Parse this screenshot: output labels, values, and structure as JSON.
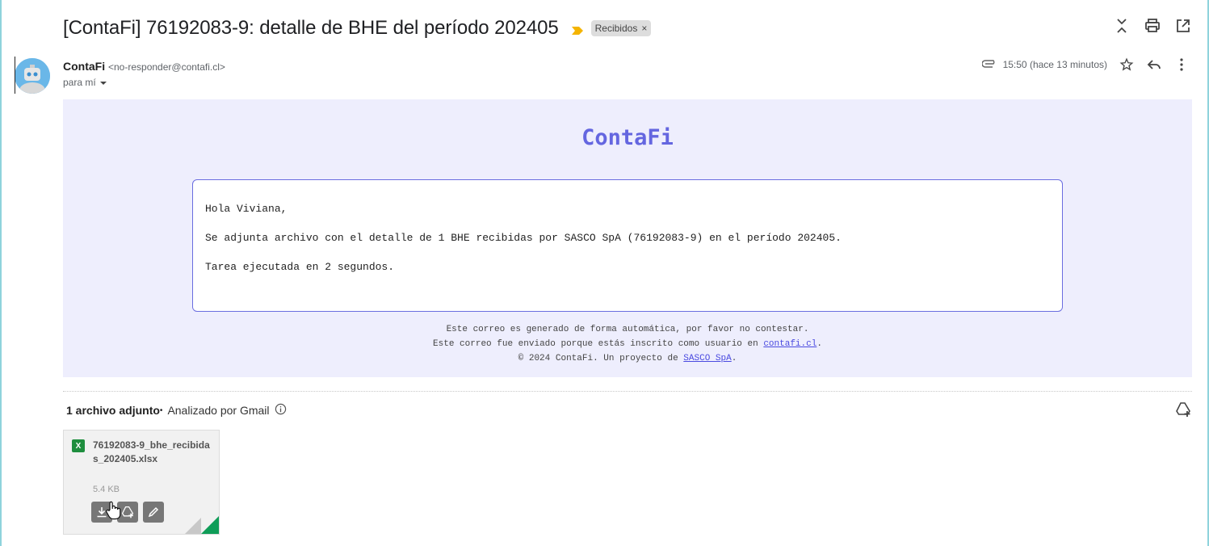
{
  "subject": "[ContaFi] 76192083-9: detalle de BHE del período 202405",
  "label": {
    "name": "Recibidos",
    "remove": "×"
  },
  "sender": {
    "name": "ContaFi",
    "email": "<no-responder@contafi.cl>",
    "to": "para mí"
  },
  "time": "15:50 (hace 13 minutos)",
  "body": {
    "brand": "ContaFi",
    "greeting": "Hola Viviana,",
    "line1": "Se adjunta archivo con el detalle de 1 BHE recibidas por SASCO SpA (76192083-9) en el período 202405.",
    "line2": "Tarea ejecutada en 2 segundos.",
    "footer1": "Este correo es generado de forma automática, por favor no contestar.",
    "footer2_pre": "Este correo fue enviado porque estás inscrito como usuario en ",
    "footer2_link": "contafi.cl",
    "footer2_post": ".",
    "footer3_pre": "© 2024 ContaFi. Un proyecto de ",
    "footer3_link": "SASCO SpA",
    "footer3_post": "."
  },
  "attachments": {
    "count_label": "1 archivo adjunto",
    "separator": "•",
    "scan_label": "Analizado por Gmail",
    "file": {
      "type_letter": "X",
      "name": "76192083-9_bhe_recibidas_202405.xlsx",
      "size": "5.4 KB"
    }
  },
  "colors": {
    "brand": "#6466e0",
    "body_bg": "#eeeefd",
    "excel": "#1e8e3e"
  }
}
